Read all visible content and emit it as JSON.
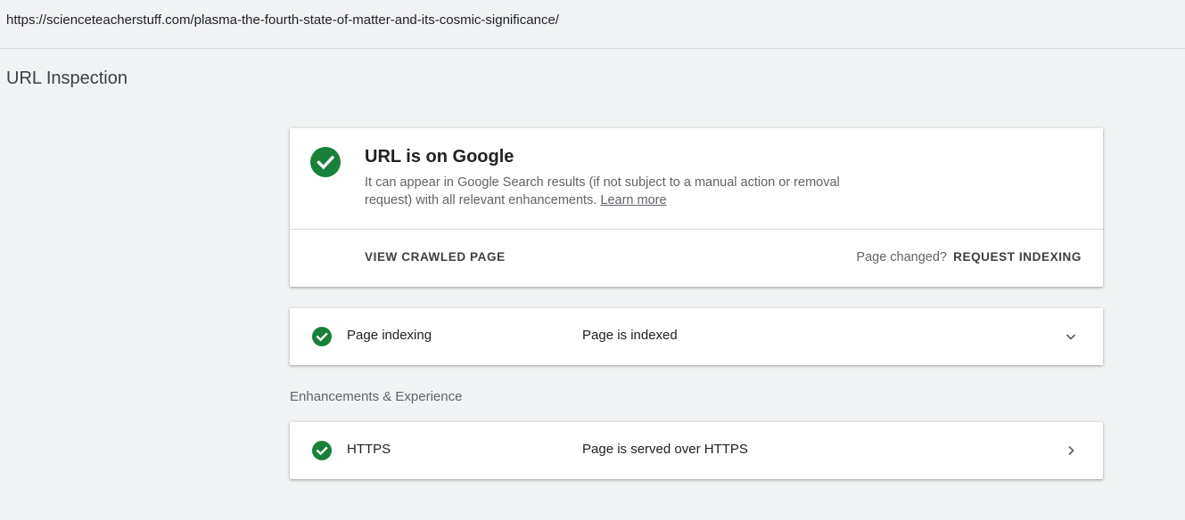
{
  "url_bar": {
    "url": "https://scienceteacherstuff.com/plasma-the-fourth-state-of-matter-and-its-cosmic-significance/"
  },
  "header": {
    "title": "URL Inspection"
  },
  "summary": {
    "title": "URL is on Google",
    "description": "It can appear in Google Search results (if not subject to a manual action or removal request) with all relevant enhancements.",
    "learn_more": "Learn more",
    "view_crawled_label": "VIEW CRAWLED PAGE",
    "page_changed_label": "Page changed?",
    "request_indexing_label": "REQUEST INDEXING",
    "status_icon": "check-circle-icon"
  },
  "indexing": {
    "label": "Page indexing",
    "value": "Page is indexed",
    "status_icon": "check-circle-icon",
    "toggle_icon": "chevron-down-icon"
  },
  "enhancements": {
    "heading": "Enhancements & Experience",
    "items": [
      {
        "label": "HTTPS",
        "value": "Page is served over HTTPS",
        "status_icon": "check-circle-icon",
        "toggle_icon": "chevron-right-icon"
      }
    ]
  },
  "colors": {
    "background": "#f1f3f4",
    "success_green": "#188038",
    "card": "#ffffff",
    "divider": "#dadce0"
  }
}
